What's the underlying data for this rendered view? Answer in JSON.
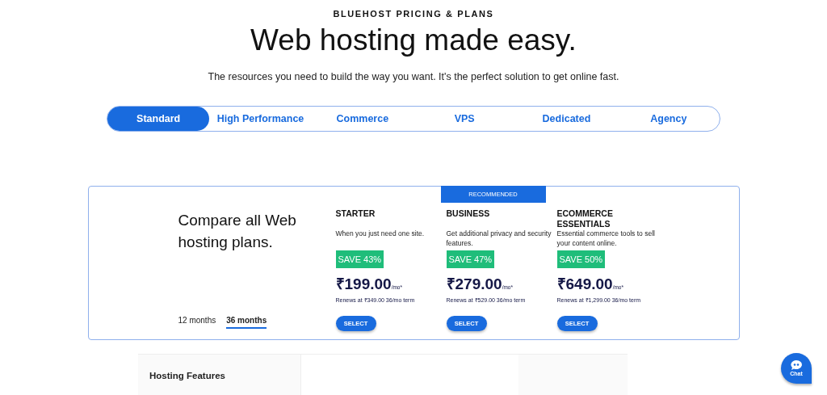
{
  "eyebrow": "BLUEHOST PRICING & PLANS",
  "title": "Web hosting made easy.",
  "subtitle": "The resources you need to build the way you want. It's the perfect solution to get online fast.",
  "tabs": [
    {
      "label": "Standard",
      "selected": true
    },
    {
      "label": "High Performance",
      "selected": false
    },
    {
      "label": "Commerce",
      "selected": false
    },
    {
      "label": "VPS",
      "selected": false
    },
    {
      "label": "Dedicated",
      "selected": false
    },
    {
      "label": "Agency",
      "selected": false
    }
  ],
  "compare": {
    "heading": "Compare all Web hosting plans.",
    "terms": [
      {
        "label": "12 months",
        "selected": false
      },
      {
        "label": "36 months",
        "selected": true
      }
    ]
  },
  "recommended_label": "RECOMMENDED",
  "plans": [
    {
      "name": "STARTER",
      "recommended": false,
      "description": "When you just need one site.",
      "save": "SAVE 43%",
      "price": "₹199.00",
      "unit": "/mo*",
      "renews": "Renews at ₹349.00 36/mo term",
      "button": "SELECT"
    },
    {
      "name": "BUSINESS",
      "recommended": true,
      "description": "Get additional privacy and security features.",
      "save": "SAVE 47%",
      "price": "₹279.00",
      "unit": "/mo*",
      "renews": "Renews at ₹529.00 36/mo term",
      "button": "SELECT"
    },
    {
      "name": "ECOMMERCE ESSENTIALS",
      "recommended": false,
      "description": "Essential commerce tools to sell your content online.",
      "save": "SAVE 50%",
      "price": "₹649.00",
      "unit": "/mo*",
      "renews": "Renews at ₹1,299.00 36/mo term",
      "button": "SELECT"
    }
  ],
  "features": {
    "heading": "Hosting Features"
  },
  "chat": {
    "label": "Chat"
  }
}
